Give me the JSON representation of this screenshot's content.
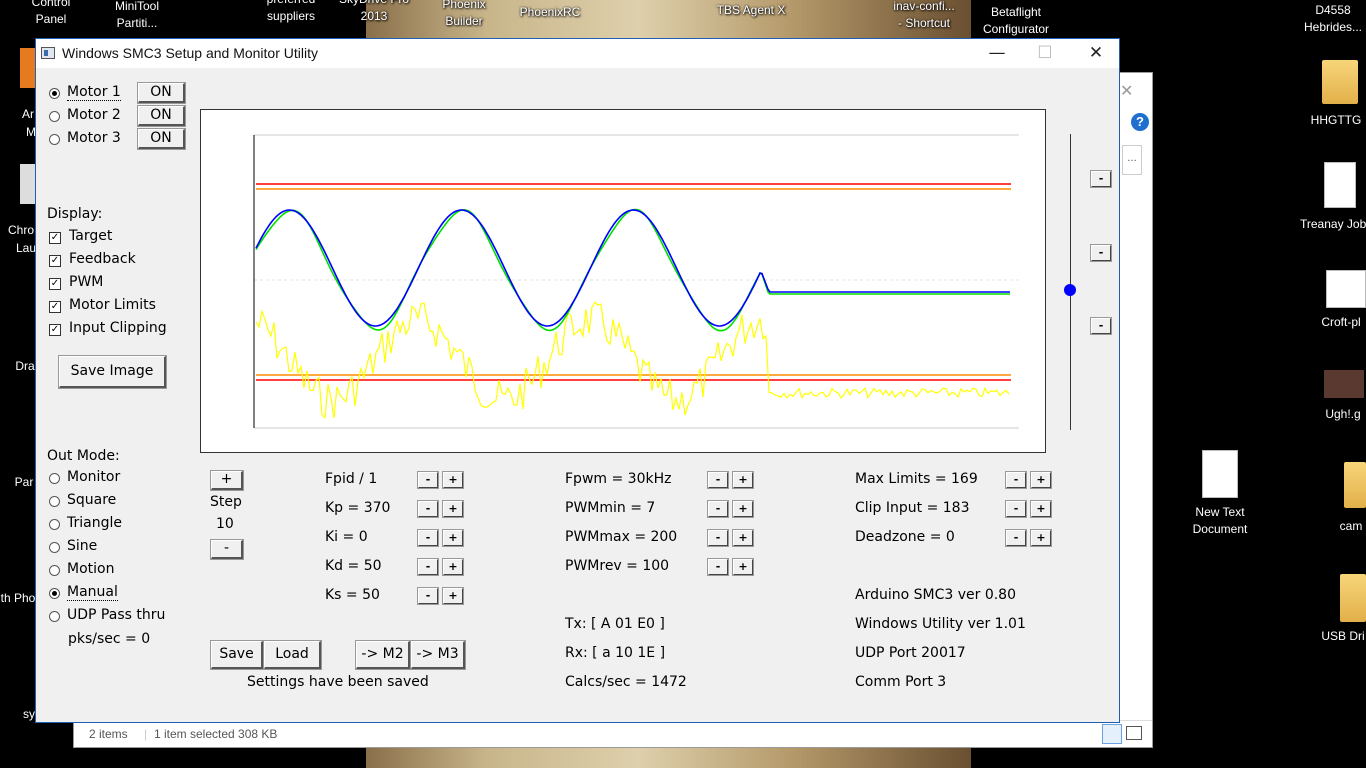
{
  "desktop": {
    "top_labels": [
      {
        "id": "control-panel",
        "text": "Control\nPanel"
      },
      {
        "id": "minitool",
        "text": "MiniTool\nPartiti..."
      },
      {
        "id": "preferred",
        "text": "preferred\nsuppliers"
      },
      {
        "id": "skydrive",
        "text": "SkyDrive Pro\n2013"
      },
      {
        "id": "phoenix-builder",
        "text": "Phoenix\nBuilder"
      },
      {
        "id": "phoenixrc",
        "text": "PhoenixRC"
      },
      {
        "id": "tbs-agent",
        "text": "TBS Agent X"
      },
      {
        "id": "inav",
        "text": "inav-confi...\n- Shortcut"
      },
      {
        "id": "betaflight",
        "text": "Betaflight\nConfigurator"
      }
    ],
    "right_labels": [
      {
        "id": "d4558",
        "text": "D4558\nHebrides..."
      },
      {
        "id": "hhgttg",
        "text": "HHGTTG"
      },
      {
        "id": "treanay",
        "text": "Treanay Job"
      },
      {
        "id": "croft",
        "text": "Croft-pl"
      },
      {
        "id": "ugh",
        "text": "Ugh!.g"
      },
      {
        "id": "cam",
        "text": "cam"
      },
      {
        "id": "usb",
        "text": "USB Dri"
      }
    ],
    "new_text_document": "New Text\nDocument",
    "left_partial": [
      "Ar",
      "M",
      "Chro",
      "Lau",
      "Dra",
      "Par",
      "th Pho",
      "sy"
    ]
  },
  "explorer": {
    "items_count": "2 items",
    "selection": "1 item selected  308 KB"
  },
  "window": {
    "title": "Windows SMC3 Setup and Monitor Utility",
    "minimize": "—",
    "maximize": "☐",
    "close": "✕"
  },
  "motors": [
    {
      "label": "Motor 1",
      "selected": true,
      "state": "ON"
    },
    {
      "label": "Motor 2",
      "selected": false,
      "state": "ON"
    },
    {
      "label": "Motor 3",
      "selected": false,
      "state": "ON"
    }
  ],
  "display": {
    "heading": "Display:",
    "options": [
      {
        "label": "Target",
        "checked": true
      },
      {
        "label": "Feedback",
        "checked": true
      },
      {
        "label": "PWM",
        "checked": true
      },
      {
        "label": "Motor Limits",
        "checked": true
      },
      {
        "label": "Input Clipping",
        "checked": true
      }
    ],
    "save_image": "Save Image"
  },
  "out_mode": {
    "heading": "Out Mode:",
    "options": [
      {
        "label": "Monitor",
        "selected": false
      },
      {
        "label": "Square",
        "selected": false
      },
      {
        "label": "Triangle",
        "selected": false
      },
      {
        "label": "Sine",
        "selected": false
      },
      {
        "label": "Motion",
        "selected": false
      },
      {
        "label": "Manual",
        "selected": true
      },
      {
        "label": "UDP Pass thru",
        "selected": false
      }
    ],
    "pks_sec": "pks/sec = 0"
  },
  "step": {
    "plus": "+",
    "label": "Step",
    "value": "10",
    "minus": "-"
  },
  "pid": {
    "items": [
      "Fpid / 1",
      "Kp = 370",
      "Ki = 0",
      "Kd = 50",
      "Ks = 50"
    ]
  },
  "pwm": {
    "items": [
      "Fpwm = 30kHz",
      "PWMmin = 7",
      "PWMmax = 200",
      "PWMrev = 100"
    ]
  },
  "limits": {
    "items": [
      "Max Limits = 169",
      "Clip Input = 183",
      "Deadzone = 0"
    ]
  },
  "buttons": {
    "save": "Save",
    "load": "Load",
    "to_m2": "-> M2",
    "to_m3": "-> M3"
  },
  "status": {
    "saved": "Settings have been saved",
    "tx": "Tx: [ A 01 E0 ]",
    "rx": "Rx: [ a 10 1E ]",
    "calcs": "Calcs/sec = 1472",
    "arduino_ver": "Arduino SMC3 ver 0.80",
    "windows_ver": "Windows Utility ver 1.01",
    "udp_port": "UDP Port 20017",
    "comm_port": "Comm Port 3"
  },
  "slider_level": 0.5,
  "stepper": {
    "minus": "-",
    "plus": "+"
  },
  "colors": {
    "target": "#0000ff",
    "feedback": "#00e000",
    "pwm": "#ffff00",
    "motor_limits": "#ff0000",
    "input_clipping": "#ff8c00",
    "title_border": "#1e5fb4"
  }
}
